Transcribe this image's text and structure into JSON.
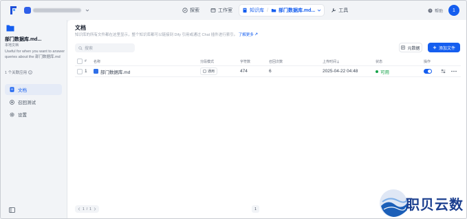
{
  "topbar": {
    "workspace_text": "",
    "nav": [
      {
        "id": "explore",
        "label": "探索"
      },
      {
        "id": "studio",
        "label": "工作室"
      },
      {
        "id": "knowledge",
        "label": "知识库",
        "current": "部门数据库.md..."
      },
      {
        "id": "tools",
        "label": "工具"
      }
    ],
    "help_label": "帮助",
    "user_initial": "1"
  },
  "sidebar": {
    "kb_title": "部门数据库.md...",
    "kb_type": "本地文档",
    "kb_description": "Useful for when you want to answer queries about the 部门数据库.md",
    "apps_using": "1 个关联应用",
    "items": [
      {
        "id": "documents",
        "label": "文档",
        "icon": "document-icon",
        "active": true
      },
      {
        "id": "recall",
        "label": "召回测试",
        "icon": "target-icon",
        "active": false
      },
      {
        "id": "settings",
        "label": "设置",
        "icon": "gear-icon",
        "active": false
      }
    ]
  },
  "main": {
    "title": "文档",
    "description": "知识库的所有文件都在这里显示，整个知识库都可以链接到 Dify 引用或通过 Chat 插件进行索引。",
    "learn_more": "了解更多",
    "search_placeholder": "搜索",
    "metadata_button": "元数据",
    "add_file_button": "添加文件",
    "table": {
      "headers": [
        "#",
        "名称",
        "分段模式",
        "字符数",
        "召回次数",
        "上传时间",
        "状态",
        "操作"
      ],
      "rows": [
        {
          "index": "1",
          "name": "部门数据库.md",
          "chunk_mode": "通用",
          "chars": "474",
          "recall_count": "6",
          "upload_time": "2025-04-22 04:48",
          "status": "可用",
          "enabled": true
        }
      ]
    },
    "pagination": {
      "current": "1",
      "total": "1",
      "page_label": "1"
    }
  },
  "watermark": {
    "text": "职贝云数"
  },
  "colors": {
    "accent": "#155eef",
    "status_ok": "#16a34a",
    "background": "#f2f4f7"
  }
}
